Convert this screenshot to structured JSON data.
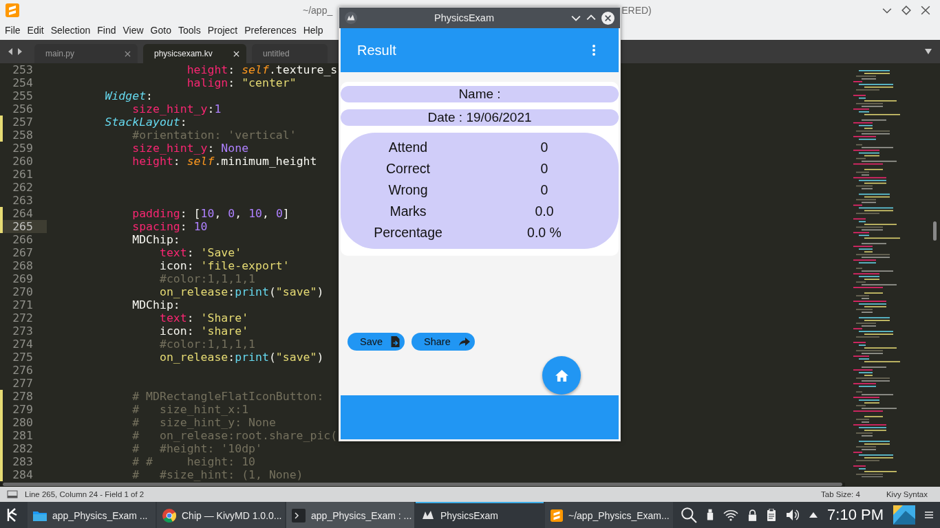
{
  "editor": {
    "title_left": "~/app_",
    "title_right": "ERED)",
    "menu": [
      "File",
      "Edit",
      "Selection",
      "Find",
      "View",
      "Goto",
      "Tools",
      "Project",
      "Preferences",
      "Help"
    ],
    "tabs": [
      {
        "label": "main.py",
        "selected": false
      },
      {
        "label": "physicsexam.kv",
        "selected": true
      },
      {
        "label": "untitled",
        "selected": false
      }
    ],
    "lines": [
      {
        "number": "253",
        "modified": false,
        "current": false,
        "tokens": [
          {
            "text": "                    height",
            "kind": "key"
          },
          {
            "text": ": ",
            "kind": "plain"
          },
          {
            "text": "self",
            "kind": "self"
          },
          {
            "text": ".texture_s",
            "kind": "plain"
          }
        ]
      },
      {
        "number": "254",
        "modified": false,
        "current": false,
        "tokens": [
          {
            "text": "                    halign",
            "kind": "key"
          },
          {
            "text": ": ",
            "kind": "plain"
          },
          {
            "text": "\"center\"",
            "kind": "string"
          }
        ]
      },
      {
        "number": "255",
        "modified": false,
        "current": false,
        "tokens": [
          {
            "text": "        Widget",
            "kind": "class"
          },
          {
            "text": ":",
            "kind": "plain"
          }
        ]
      },
      {
        "number": "256",
        "modified": false,
        "current": false,
        "tokens": [
          {
            "text": "            size_hint_y",
            "kind": "key"
          },
          {
            "text": ":",
            "kind": "plain"
          },
          {
            "text": "1",
            "kind": "number"
          }
        ]
      },
      {
        "number": "257",
        "modified": true,
        "current": false,
        "tokens": [
          {
            "text": "        StackLayout",
            "kind": "class"
          },
          {
            "text": ":",
            "kind": "plain"
          }
        ]
      },
      {
        "number": "258",
        "modified": true,
        "current": false,
        "tokens": [
          {
            "text": "            #orientation: 'vertical'",
            "kind": "comment"
          }
        ]
      },
      {
        "number": "259",
        "modified": false,
        "current": false,
        "tokens": [
          {
            "text": "            size_hint_y",
            "kind": "key"
          },
          {
            "text": ": ",
            "kind": "plain"
          },
          {
            "text": "None",
            "kind": "number"
          }
        ]
      },
      {
        "number": "260",
        "modified": false,
        "current": false,
        "tokens": [
          {
            "text": "            height",
            "kind": "key"
          },
          {
            "text": ": ",
            "kind": "plain"
          },
          {
            "text": "self",
            "kind": "self"
          },
          {
            "text": ".minimum_height",
            "kind": "plain"
          }
        ]
      },
      {
        "number": "261",
        "modified": false,
        "current": false
      },
      {
        "number": "262",
        "modified": false,
        "current": false
      },
      {
        "number": "263",
        "modified": false,
        "current": false
      },
      {
        "number": "264",
        "modified": true,
        "current": false,
        "tokens": [
          {
            "text": "            padding",
            "kind": "key"
          },
          {
            "text": ": [",
            "kind": "plain"
          },
          {
            "text": "10",
            "kind": "number"
          },
          {
            "text": ", ",
            "kind": "plain"
          },
          {
            "text": "0",
            "kind": "number"
          },
          {
            "text": ", ",
            "kind": "plain"
          },
          {
            "text": "10",
            "kind": "number"
          },
          {
            "text": ", ",
            "kind": "plain"
          },
          {
            "text": "0",
            "kind": "number"
          },
          {
            "text": "]",
            "kind": "plain"
          }
        ]
      },
      {
        "number": "265",
        "modified": true,
        "current": true,
        "tokens": [
          {
            "text": "            spacing",
            "kind": "key"
          },
          {
            "text": ": ",
            "kind": "plain"
          },
          {
            "text": "10",
            "kind": "number"
          }
        ]
      },
      {
        "number": "266",
        "modified": false,
        "current": false,
        "tokens": [
          {
            "text": "            MDChip:",
            "kind": "plain"
          }
        ]
      },
      {
        "number": "267",
        "modified": false,
        "current": false,
        "tokens": [
          {
            "text": "                text",
            "kind": "key"
          },
          {
            "text": ": ",
            "kind": "plain"
          },
          {
            "text": "'Save'",
            "kind": "string"
          }
        ]
      },
      {
        "number": "268",
        "modified": false,
        "current": false,
        "tokens": [
          {
            "text": "                icon: ",
            "kind": "plain"
          },
          {
            "text": "'file-export'",
            "kind": "string"
          }
        ]
      },
      {
        "number": "269",
        "modified": false,
        "current": false,
        "tokens": [
          {
            "text": "                #color:1,1,1,1",
            "kind": "comment"
          }
        ]
      },
      {
        "number": "270",
        "modified": false,
        "current": false,
        "tokens": [
          {
            "text": "                on_release",
            "kind": "string"
          },
          {
            "text": ":",
            "kind": "plain"
          },
          {
            "text": "print",
            "kind": "func"
          },
          {
            "text": "(",
            "kind": "plain"
          },
          {
            "text": "\"save\"",
            "kind": "string"
          },
          {
            "text": ")",
            "kind": "plain"
          }
        ]
      },
      {
        "number": "271",
        "modified": false,
        "current": false,
        "tokens": [
          {
            "text": "            MDChip:",
            "kind": "plain"
          }
        ]
      },
      {
        "number": "272",
        "modified": false,
        "current": false,
        "tokens": [
          {
            "text": "                text",
            "kind": "key"
          },
          {
            "text": ": ",
            "kind": "plain"
          },
          {
            "text": "'Share'",
            "kind": "string"
          }
        ]
      },
      {
        "number": "273",
        "modified": false,
        "current": false,
        "tokens": [
          {
            "text": "                icon: ",
            "kind": "plain"
          },
          {
            "text": "'share'",
            "kind": "string"
          }
        ]
      },
      {
        "number": "274",
        "modified": false,
        "current": false,
        "tokens": [
          {
            "text": "                #color:1,1,1,1",
            "kind": "comment"
          }
        ]
      },
      {
        "number": "275",
        "modified": false,
        "current": false,
        "tokens": [
          {
            "text": "                on_release",
            "kind": "string"
          },
          {
            "text": ":",
            "kind": "plain"
          },
          {
            "text": "print",
            "kind": "func"
          },
          {
            "text": "(",
            "kind": "plain"
          },
          {
            "text": "\"save\"",
            "kind": "string"
          },
          {
            "text": ")",
            "kind": "plain"
          }
        ]
      },
      {
        "number": "276",
        "modified": false,
        "current": false
      },
      {
        "number": "277",
        "modified": false,
        "current": false
      },
      {
        "number": "278",
        "modified": true,
        "current": false,
        "tokens": [
          {
            "text": "            # MDRectangleFlatIconButton:",
            "kind": "comment"
          }
        ]
      },
      {
        "number": "279",
        "modified": true,
        "current": false,
        "tokens": [
          {
            "text": "            #   size_hint_x:1",
            "kind": "comment"
          }
        ]
      },
      {
        "number": "280",
        "modified": true,
        "current": false,
        "tokens": [
          {
            "text": "            #   size_hint_y: None",
            "kind": "comment"
          }
        ]
      },
      {
        "number": "281",
        "modified": true,
        "current": false,
        "tokens": [
          {
            "text": "            #   on_release:root.share_pic(",
            "kind": "comment"
          }
        ]
      },
      {
        "number": "282",
        "modified": true,
        "current": false,
        "tokens": [
          {
            "text": "            #   #height: '10dp'",
            "kind": "comment"
          }
        ]
      },
      {
        "number": "283",
        "modified": true,
        "current": false,
        "tokens": [
          {
            "text": "            # #     height: 10",
            "kind": "comment"
          }
        ]
      },
      {
        "number": "284",
        "modified": true,
        "current": false,
        "tokens": [
          {
            "text": "            #   #size_hint: (1, None)",
            "kind": "comment"
          }
        ]
      }
    ],
    "status": {
      "position": "Line 265, Column 24 - Field 1 of 2",
      "tab_size": "Tab Size: 4",
      "syntax": "Kivy Syntax"
    }
  },
  "app": {
    "window_title": "PhysicsExam",
    "toolbar_title": "Result",
    "name_label": "Name :",
    "date_label": "Date : 19/06/2021",
    "stats": [
      {
        "label": "Attend",
        "value": "0"
      },
      {
        "label": "Correct",
        "value": "0"
      },
      {
        "label": "Wrong",
        "value": "0"
      },
      {
        "label": "Marks",
        "value": "0.0"
      },
      {
        "label": "Percentage",
        "value": "0.0 %"
      }
    ],
    "chips": [
      {
        "label": "Save",
        "kind": "save"
      },
      {
        "label": "Share",
        "kind": "share"
      }
    ]
  },
  "taskbar": {
    "items": [
      {
        "label": "app_Physics_Exam ...",
        "kind": "folder",
        "selected": false,
        "hovered": false
      },
      {
        "label": "Chip — KivyMD 1.0.0...",
        "kind": "browser",
        "selected": false,
        "hovered": false
      },
      {
        "label": "app_Physics_Exam : ...",
        "kind": "terminal",
        "selected": false,
        "hovered": true
      },
      {
        "label": "PhysicsExam",
        "kind": "kivy",
        "selected": true,
        "hovered": false
      },
      {
        "label": "~/app_Physics_Exam...",
        "kind": "sublime",
        "selected": false,
        "hovered": false
      }
    ],
    "clock": "7:10 PM"
  }
}
